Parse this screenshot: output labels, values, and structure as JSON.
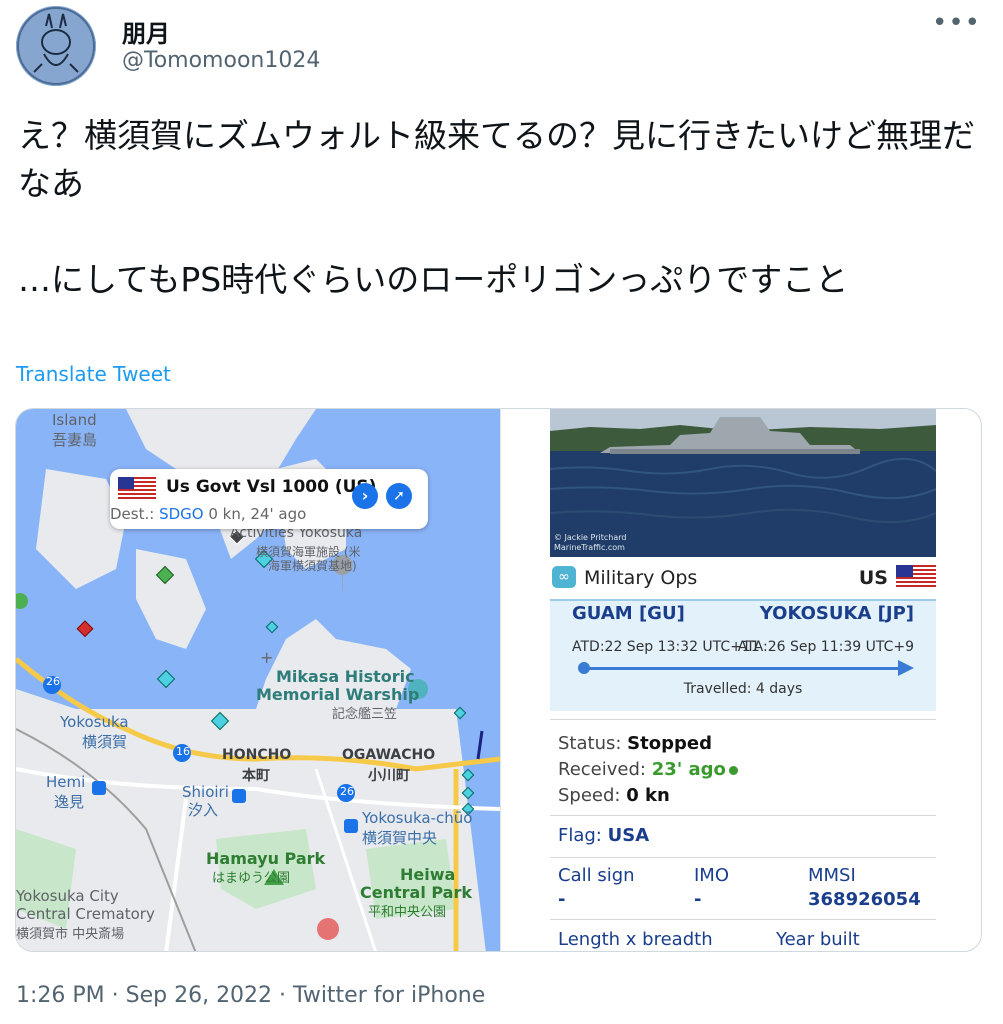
{
  "tweet": {
    "display_name": "朋月",
    "handle": "@Tomomoon1024",
    "more_icon": "more-icon",
    "text": "え？横須賀にズムウォルト級来てるの？見に行きたいけど無理だなあ\n\n…にしてもPS時代ぐらいのローポリゴンっぷりですこと",
    "translate_label": "Translate Tweet",
    "timestamp": "1:26 PM · Sep 26, 2022 · Twitter for iPhone"
  },
  "map": {
    "labels": {
      "island": "Island",
      "island_jp": "吾妻島",
      "activities_line1": "Activities Yokosuka",
      "activities_line2": "横須賀海軍施設 (米",
      "activities_line3": "海軍横須賀基地)",
      "mikasa1": "Mikasa Historic",
      "mikasa2": "Memorial Warship",
      "mikasa_jp": "記念艦三笠",
      "yokosuka": "Yokosuka",
      "yokosuka_jp": "横須賀",
      "honcho": "HONCHO",
      "honcho_jp": "本町",
      "ogawacho": "OGAWACHO",
      "ogawacho_jp": "小川町",
      "hemi": "Hemi",
      "hemi_jp": "逸見",
      "shioiri": "Shioiri",
      "shioiri_jp": "汐入",
      "chuo": "Yokosuka-chūō",
      "chuo_jp": "横須賀中央",
      "hamayu": "Hamayu Park",
      "hamayu_jp": "はまゆう公園",
      "heiwa1": "Heiwa",
      "heiwa2": "Central Park",
      "heiwa_jp": "平和中央公園",
      "crem1": "Yokosuka City",
      "crem2": "Central Crematory",
      "crem_jp": "横須賀市 中央斎場",
      "route16": "16",
      "route26a": "26",
      "route26b": "26"
    },
    "popup": {
      "vessel_name": "Us Govt Vsl 1000 (US)",
      "dest_label": "Dest.:",
      "dest_code": "SDGO",
      "dest_info": "0 kn, 24' ago",
      "go_icon": "chevron-right-icon",
      "track_icon": "route-icon"
    }
  },
  "vessel": {
    "photo_credit_1": "© Jackie Pritchard",
    "photo_credit_2": "MarineTraffic.com",
    "type": "Military Ops",
    "country": "US",
    "from": "GUAM [GU]",
    "to": "YOKOSUKA [JP]",
    "atd": "ATD:22 Sep 13:32 UTC+11",
    "ata": "ATA:26 Sep 11:39 UTC+9",
    "travelled": "Travelled: 4 days",
    "status_label": "Status:",
    "status_value": "Stopped",
    "received_label": "Received:",
    "received_value": "23' ago",
    "speed_label": "Speed:",
    "speed_value": "0 kn",
    "flag_label": "Flag:",
    "flag_value": "USA",
    "callsign_label": "Call sign",
    "callsign_value": "-",
    "imo_label": "IMO",
    "imo_value": "-",
    "mmsi_label": "MMSI",
    "mmsi_value": "368926054",
    "length_label": "Length x breadth",
    "year_label": "Year built"
  },
  "colors": {
    "link": "#1d9bf0",
    "water": "#8ab4f8",
    "land": "#e8eaed",
    "route_blue": "#1a3e8c"
  }
}
